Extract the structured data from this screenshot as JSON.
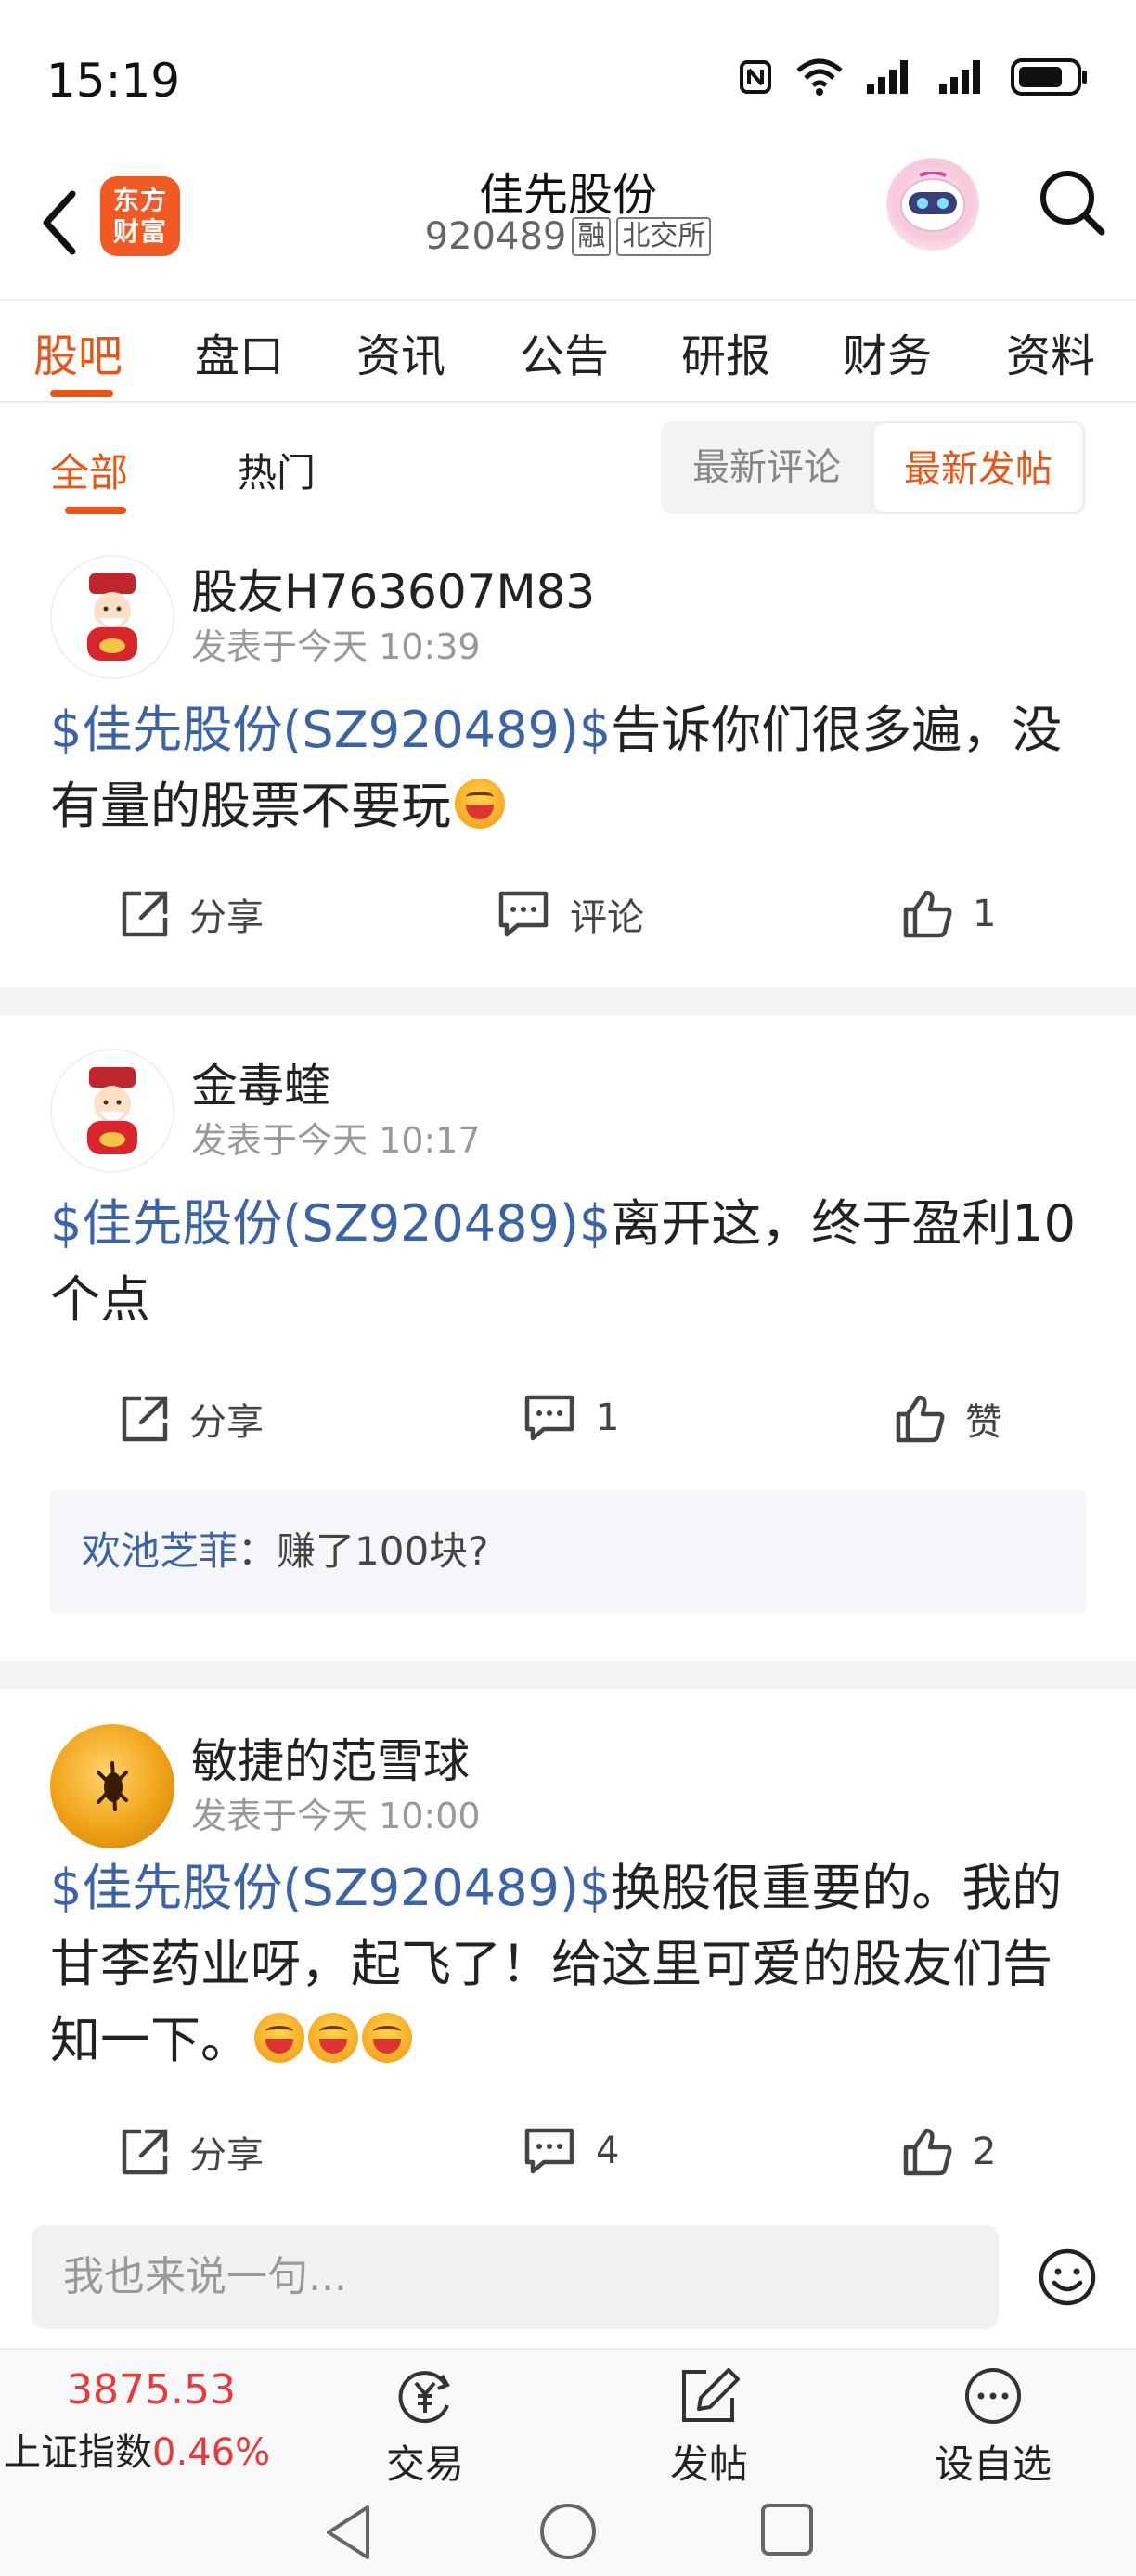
{
  "status_bar": {
    "time": "15:19"
  },
  "header": {
    "logo_line1": "东方",
    "logo_line2": "财富",
    "stock_name": "佳先股份",
    "stock_code": "920489",
    "tag_margin": "融",
    "tag_exchange": "北交所"
  },
  "tabs": [
    "股吧",
    "盘口",
    "资讯",
    "公告",
    "研报",
    "财务",
    "资料"
  ],
  "subtabs": {
    "all": "全部",
    "hot": "热门"
  },
  "sort": {
    "latest_comment": "最新评论",
    "latest_post": "最新发帖"
  },
  "posts": [
    {
      "user": "股友H763607M83",
      "time": "发表于今天 10:39",
      "tag": "$佳先股份(SZ920489)$",
      "text": "告诉你们很多遍，没有量的股票不要玩",
      "share": "分享",
      "comment": "评论",
      "likes": "1"
    },
    {
      "user": "金毒蝰",
      "time": "发表于今天 10:17",
      "tag": "$佳先股份(SZ920489)$",
      "text": "离开这，终于盈利10个点",
      "share": "分享",
      "comment": "1",
      "likes": "赞",
      "reply_user": "欢池芝菲",
      "reply_text": "：赚了100块?"
    },
    {
      "user": "敏捷的范雪球",
      "time": "发表于今天 10:00",
      "tag": "$佳先股份(SZ920489)$",
      "text": "换股很重要的。我的甘李药业呀，起飞了！给这里可爱的股友们告知一下。",
      "share": "分享",
      "comment": "4",
      "likes": "2"
    }
  ],
  "comment_input": {
    "placeholder": "我也来说一句..."
  },
  "bottom_nav": {
    "index_value": "3875.53",
    "index_name": "上证指数",
    "index_change": "0.46%",
    "trade": "交易",
    "post": "发帖",
    "watchlist": "设自选"
  },
  "colors": {
    "accent": "#ea5414",
    "link": "#3a63a8",
    "up": "#e83a3a"
  }
}
